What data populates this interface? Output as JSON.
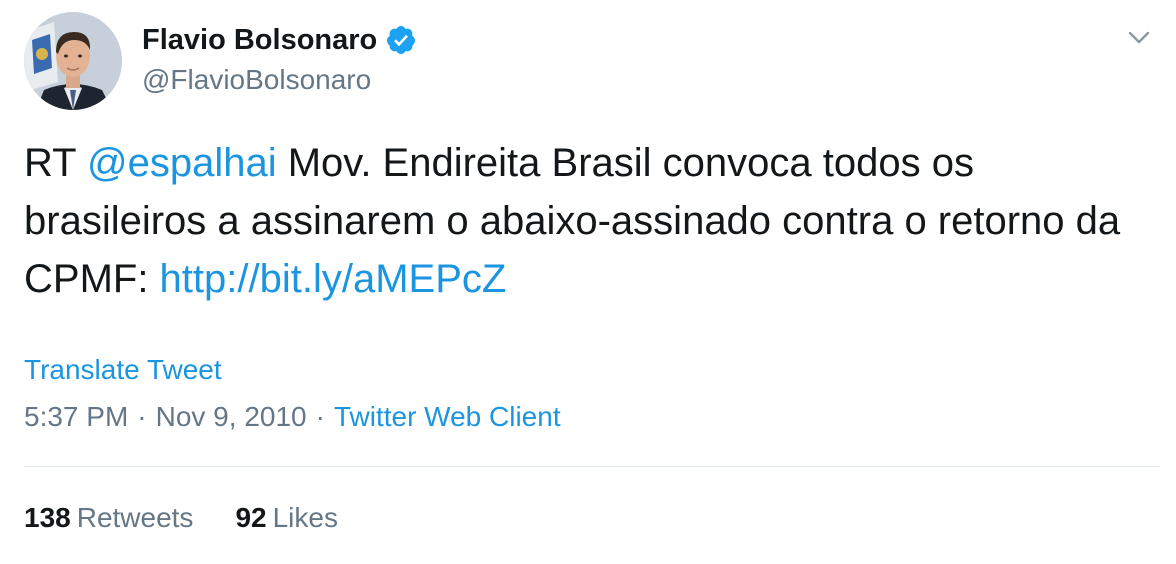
{
  "author": {
    "display_name": "Flavio Bolsonaro",
    "handle": "@FlavioBolsonaro",
    "verified": true
  },
  "tweet": {
    "prefix": "RT ",
    "mention": "@espalhai",
    "body": " Mov. Endireita Brasil convoca todos os brasileiros a assinarem o abaixo-assinado contra o retorno da CPMF: ",
    "link": "http://bit.ly/aMEPcZ"
  },
  "translate_label": "Translate Tweet",
  "meta": {
    "time": "5:37 PM",
    "separator": "·",
    "date": "Nov 9, 2010",
    "source": "Twitter Web Client"
  },
  "stats": {
    "retweets_count": "138",
    "retweets_label": "Retweets",
    "likes_count": "92",
    "likes_label": "Likes"
  },
  "colors": {
    "link_blue": "#1b95e0",
    "text_primary": "#14171a",
    "text_secondary": "#657786",
    "divider": "#e1e8ed"
  },
  "icons": {
    "verified": "verified-badge-icon",
    "menu": "chevron-down-icon"
  }
}
